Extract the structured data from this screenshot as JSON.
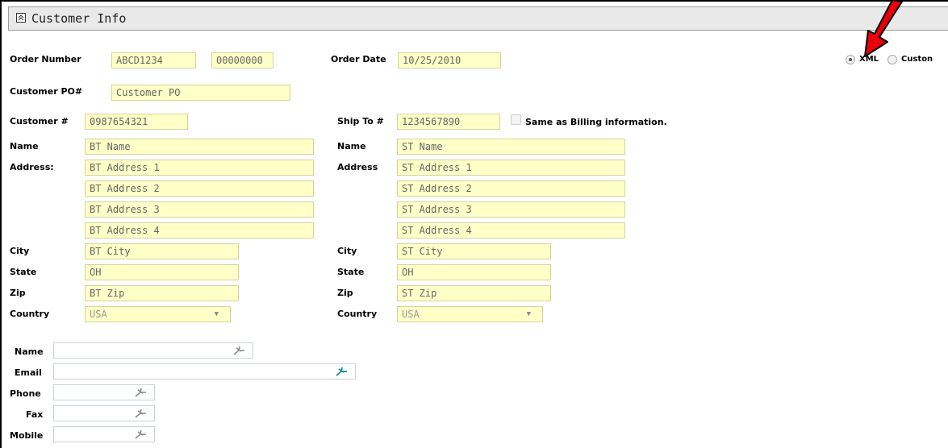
{
  "panel": {
    "title": "Customer Info"
  },
  "order": {
    "number_label": "Order Number",
    "number_value": "ABCD1234",
    "number_value2": "00000000",
    "date_label": "Order Date",
    "date_value": "10/25/2010",
    "po_label": "Customer PO#",
    "po_value": "Customer PO"
  },
  "format": {
    "option1": "XML",
    "option2": "Custon",
    "selected": "XML"
  },
  "billing": {
    "customer_label": "Customer #",
    "customer_value": "0987654321",
    "name_label": "Name",
    "name_value": "BT Name",
    "address_label": "Address:",
    "address": [
      "BT Address 1",
      "BT Address 2",
      "BT Address 3",
      "BT Address 4"
    ],
    "city_label": "City",
    "city_value": "BT City",
    "state_label": "State",
    "state_value": "OH",
    "zip_label": "Zip",
    "zip_value": "BT Zip",
    "country_label": "Country",
    "country_value": "USA"
  },
  "shipping": {
    "shipto_label": "Ship To #",
    "shipto_value": "1234567890",
    "same_label": "Same as Billing information.",
    "name_label": "Name",
    "name_value": "ST Name",
    "address_label": "Address",
    "address": [
      "ST Address 1",
      "ST Address 2",
      "ST Address 3",
      "ST Address 4"
    ],
    "city_label": "City",
    "city_value": "ST City",
    "state_label": "State",
    "state_value": "OH",
    "zip_label": "Zip",
    "zip_value": "ST Zip",
    "country_label": "Country",
    "country_value": "USA"
  },
  "contact": {
    "name_label": "Name",
    "email_label": "Email",
    "phone_label": "Phone",
    "fax_label": "Fax",
    "mobile_label": "Mobile"
  },
  "colors": {
    "field_bg": "#ffffc8",
    "header_bg": "#e9e9e9",
    "annotation_arrow": "#e8000b"
  },
  "icons": {
    "collapse": "double-chevron-up-icon",
    "lookup": "pin-icon",
    "annotation": "red-arrow"
  }
}
